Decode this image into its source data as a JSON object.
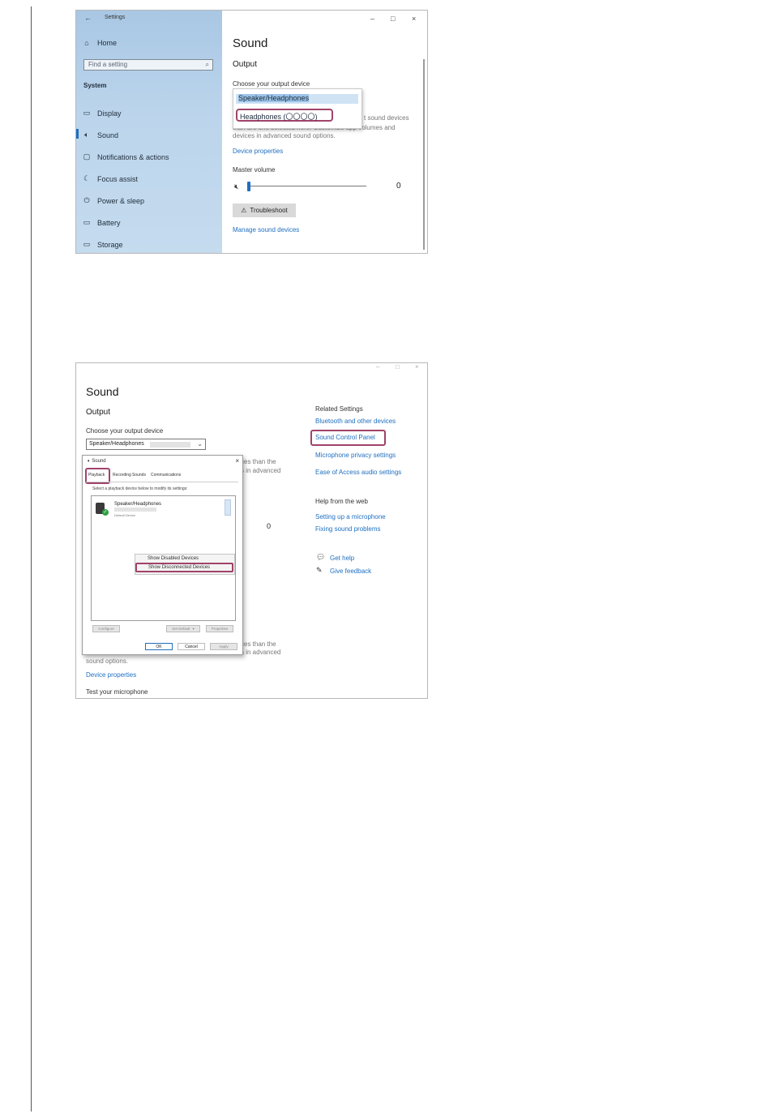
{
  "settings": {
    "window_title": "Settings",
    "back_icon": "arrow-left-icon",
    "controls": {
      "minimize": "–",
      "maximize": "□",
      "close": "×"
    },
    "sidebar": {
      "home": "Home",
      "search_placeholder": "Find a setting",
      "section": "System",
      "items": [
        {
          "label": "Display",
          "icon": "monitor-icon",
          "glyph": "▭"
        },
        {
          "label": "Sound",
          "icon": "speaker-icon",
          "glyph": "🔈",
          "selected": true
        },
        {
          "label": "Notifications & actions",
          "icon": "notification-icon",
          "glyph": "▢"
        },
        {
          "label": "Focus assist",
          "icon": "moon-icon",
          "glyph": "☾"
        },
        {
          "label": "Power & sleep",
          "icon": "power-icon",
          "glyph": "⏻"
        },
        {
          "label": "Battery",
          "icon": "battery-icon",
          "glyph": "▭"
        },
        {
          "label": "Storage",
          "icon": "storage-icon",
          "glyph": "▭"
        }
      ]
    },
    "main": {
      "title": "Sound",
      "output_heading": "Output",
      "choose_label": "Choose your output device",
      "dropdown_options": [
        "Speaker/Headphones",
        "Headphones (〇〇〇〇)"
      ],
      "desc_line1": "t sound devices",
      "desc_line2": "than are one selected here. Customize app volumes and",
      "desc_line3": "devices in advanced sound options.",
      "device_properties": "Device properties",
      "master_volume": "Master volume",
      "volume_value": "0",
      "troubleshoot": "Troubleshoot",
      "manage_devices": "Manage sound devices"
    }
  },
  "sound_page": {
    "controls": {
      "minimize": "–",
      "maximize": "□",
      "close": "×"
    },
    "title": "Sound",
    "output_heading": "Output",
    "choose_label": "Choose your output device",
    "selected_device": "Speaker/Headphones",
    "frag_top1": "ces than the",
    "frag_top2": "s in advanced",
    "volume_value": "0",
    "frag_bot1": "ces than the",
    "frag_bot2": "s in advanced",
    "sound_options": "sound options.",
    "device_properties": "Device properties",
    "test_mic": "Test your microphone",
    "related_heading": "Related Settings",
    "related_links": [
      "Bluetooth and other devices",
      "Sound Control Panel",
      "Microphone privacy settings",
      "Ease of Access audio settings"
    ],
    "help_heading": "Help from the web",
    "help_links": [
      "Setting up a microphone",
      "Fixing sound problems"
    ],
    "get_help": "Get help",
    "give_feedback": "Give feedback"
  },
  "control_panel": {
    "title": "Sound",
    "tabs": [
      "Playback",
      "Recording",
      "Sounds",
      "Communications"
    ],
    "instruction": "Select a playback device below to modify its settings:",
    "device_name": "Speaker/Headphones",
    "device_status": "Default Device",
    "context_menu": [
      "Show Disabled Devices",
      "Show Disconnected Devices"
    ],
    "buttons": {
      "configure": "Configure",
      "set_default": "Set Default",
      "properties": "Properties",
      "ok": "OK",
      "cancel": "Cancel",
      "apply": "Apply"
    }
  },
  "colors": {
    "accent": "#1f6fc1",
    "highlight": "#a0436a",
    "sidebar": "#b3cfe9"
  }
}
